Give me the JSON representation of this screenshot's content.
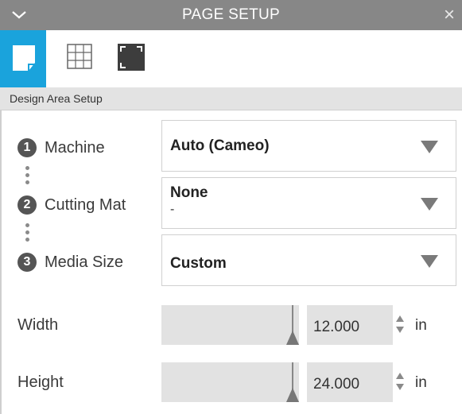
{
  "panel": {
    "title": "PAGE SETUP",
    "close_glyph": "×"
  },
  "toolbar": {
    "tools": [
      {
        "icon": "page-setup-icon",
        "active": true
      },
      {
        "icon": "grid-icon",
        "active": false
      },
      {
        "icon": "registration-marks-icon",
        "active": false
      }
    ],
    "active_color": "#1aa3dc"
  },
  "section": {
    "title": "Design Area Setup"
  },
  "steps": [
    {
      "number": "1",
      "label": "Machine",
      "value": "Auto (Cameo)",
      "sub": ""
    },
    {
      "number": "2",
      "label": "Cutting Mat",
      "value": "None",
      "sub": "-"
    },
    {
      "number": "3",
      "label": "Media Size",
      "value": "Custom",
      "sub": ""
    }
  ],
  "dimensions": {
    "width": {
      "label": "Width",
      "value": "12.000",
      "unit": "in"
    },
    "height": {
      "label": "Height",
      "value": "24.000",
      "unit": "in"
    }
  }
}
